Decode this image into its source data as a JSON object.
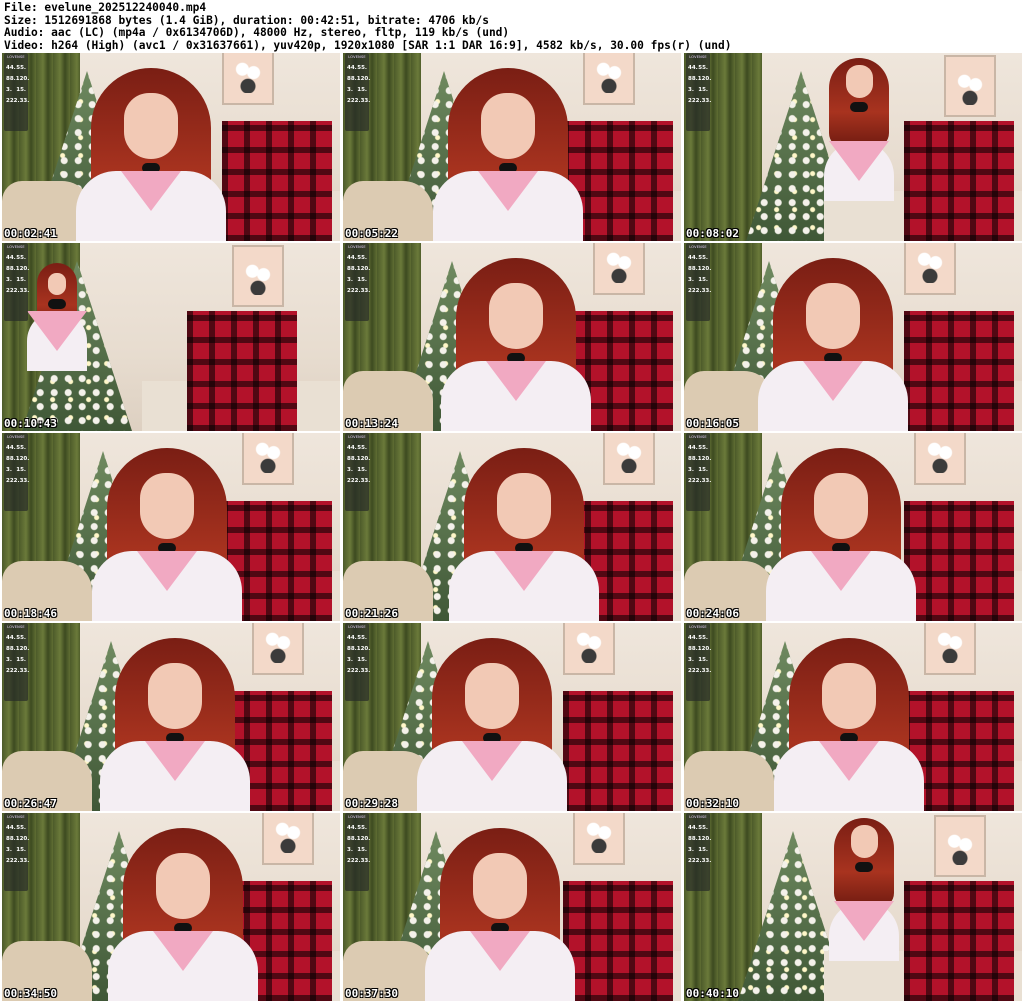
{
  "header": {
    "file": "File: evelune_202512240040.mp4",
    "size": "Size: 1512691868 bytes (1.4 GiB), duration: 00:42:51, bitrate: 4706 kb/s",
    "audio": "Audio: aac (LC) (mp4a / 0x6134706D), 48000 Hz, stereo, fltp, 119 kb/s (und)",
    "video": "Video: h264 (High) (avc1 / 0x31637661), yuv420p, 1920x1080 [SAR 1:1 DAR 16:9], 4582 kb/s, 30.00 fps(r) (und)"
  },
  "widget": {
    "title": "LOVENSE",
    "rows": [
      [
        "44.",
        "55."
      ],
      [
        "88.",
        "120."
      ],
      [
        "3.",
        "15."
      ],
      [
        "222.",
        "33."
      ]
    ]
  },
  "thumbnails": [
    {
      "timestamp": "00:02:41",
      "scene": "close"
    },
    {
      "timestamp": "00:05:22",
      "scene": "close"
    },
    {
      "timestamp": "00:08:02",
      "scene": "standing"
    },
    {
      "timestamp": "00:10:43",
      "scene": "wide"
    },
    {
      "timestamp": "00:13:24",
      "scene": "close"
    },
    {
      "timestamp": "00:16:05",
      "scene": "close"
    },
    {
      "timestamp": "00:18:46",
      "scene": "close"
    },
    {
      "timestamp": "00:21:26",
      "scene": "close"
    },
    {
      "timestamp": "00:24:06",
      "scene": "close"
    },
    {
      "timestamp": "00:26:47",
      "scene": "close"
    },
    {
      "timestamp": "00:29:28",
      "scene": "close"
    },
    {
      "timestamp": "00:32:10",
      "scene": "close"
    },
    {
      "timestamp": "00:34:50",
      "scene": "close"
    },
    {
      "timestamp": "00:37:30",
      "scene": "close"
    },
    {
      "timestamp": "00:40:10",
      "scene": "standing"
    }
  ]
}
